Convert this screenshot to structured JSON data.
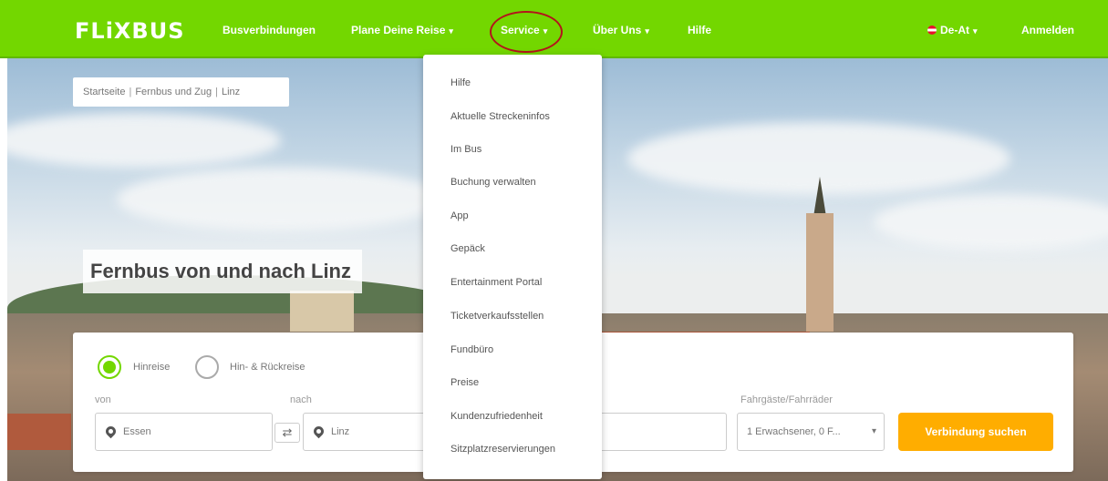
{
  "colors": {
    "brand_green": "#73d700",
    "accent_orange": "#ffad00",
    "highlight_red": "#b3141b"
  },
  "nav": {
    "logo": "FLiXBUS",
    "items": [
      {
        "label": "Busverbindungen",
        "has_chevron": false
      },
      {
        "label": "Plane Deine Reise",
        "has_chevron": true
      },
      {
        "label": "Service",
        "has_chevron": true
      },
      {
        "label": "Über Uns",
        "has_chevron": true
      },
      {
        "label": "Hilfe",
        "has_chevron": false
      }
    ],
    "language": "De-At",
    "login": "Anmelden"
  },
  "breadcrumb": [
    "Startseite",
    "Fernbus und Zug",
    "Linz"
  ],
  "hero_title": "Fernbus von und nach Linz",
  "service_menu": [
    "Hilfe",
    "Aktuelle Streckeninfos",
    "Im Bus",
    "Buchung verwalten",
    "App",
    "Gepäck",
    "Entertainment Portal",
    "Ticketverkaufsstellen",
    "Fundbüro",
    "Preise",
    "Kundenzufriedenheit",
    "Sitzplatzreservierungen"
  ],
  "search": {
    "trip_types": [
      {
        "label": "Hinreise",
        "selected": true
      },
      {
        "label": "Hin- & Rückreise",
        "selected": false
      }
    ],
    "from_label": "von",
    "from_value": "Essen",
    "to_label": "nach",
    "to_value": "Linz",
    "passengers_label": "Fahrgäste/Fahrräder",
    "passengers_value": "1 Erwachsener, 0 F...",
    "submit": "Verbindung suchen"
  }
}
